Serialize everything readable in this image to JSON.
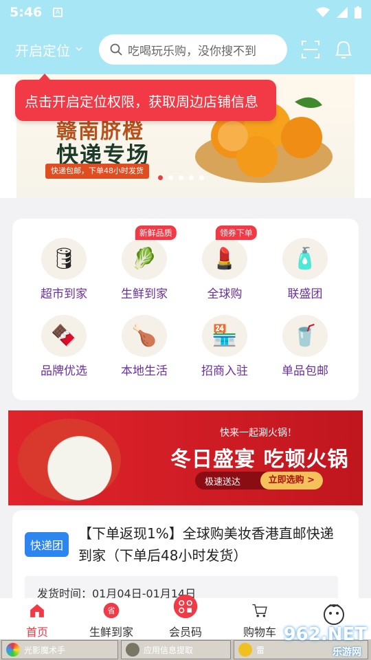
{
  "status_bar": {
    "time": "5:46",
    "icons": [
      "a-icon",
      "wifi-icon",
      "signal-icon",
      "battery-icon"
    ]
  },
  "header": {
    "location_label": "开启定位",
    "search_placeholder": "吃喝玩乐购，没你搜不到",
    "icons": [
      "scan-icon",
      "bell-icon"
    ]
  },
  "banner": {
    "title_top": "赣南脐橙",
    "title_main": "快递专场",
    "subtitle": "快递包邮，下单48小时发货",
    "dots": 5,
    "active_dot": 0
  },
  "tooltip": {
    "text": "点击开启定位权限，获取周边店铺信息"
  },
  "categories": [
    {
      "label": "超市到家",
      "tag": "",
      "icon": "oil-bottle-icon",
      "emoji": "🛢"
    },
    {
      "label": "生鲜到家",
      "tag": "新鲜品质",
      "icon": "vegetables-icon",
      "emoji": "🥬"
    },
    {
      "label": "全球购",
      "tag": "领券下单",
      "icon": "cosmetics-icon",
      "emoji": "💄"
    },
    {
      "label": "联盛团",
      "tag": "",
      "icon": "shampoo-icon",
      "emoji": "🧴"
    },
    {
      "label": "品牌优选",
      "tag": "",
      "icon": "snacks-icon",
      "emoji": "🍫"
    },
    {
      "label": "本地生活",
      "tag": "",
      "icon": "fried-chicken-icon",
      "emoji": "🍗"
    },
    {
      "label": "招商入驻",
      "tag": "",
      "icon": "store-icon",
      "emoji": "🏪"
    },
    {
      "label": "单品包邮",
      "tag": "",
      "icon": "blender-icon",
      "emoji": "🥤"
    }
  ],
  "promo": {
    "line1": "快来一起涮火锅！",
    "line2": "冬日盛宴 吃顿火锅",
    "pill_left": "极速送达",
    "pill_right": "立即选购 >"
  },
  "deal_card": {
    "badge": "快递团",
    "title": "【下单返现1%】全球购美妆香港直邮快递到家（下单后48小时发货）",
    "ship_time": "发货时间：01月04日-01月14日"
  },
  "tabbar": [
    {
      "label": "首页",
      "icon": "home-icon",
      "active": true
    },
    {
      "label": "生鲜到家",
      "icon": "fresh-icon",
      "active": false
    },
    {
      "label": "会员码",
      "icon": "member-code-icon",
      "active": false
    },
    {
      "label": "购物车",
      "icon": "cart-icon",
      "active": false
    },
    {
      "label": "",
      "icon": "profile-icon",
      "active": false
    }
  ],
  "taskbar": [
    {
      "label": "光影魔术手"
    },
    {
      "label": "应用信息提取"
    },
    {
      "label": "雷"
    }
  ],
  "watermark": {
    "brand": "962.NET",
    "site": "乐游网"
  },
  "colors": {
    "header_bg": "#a6e6f5",
    "accent_red": "#f23a46",
    "badge_blue": "#2d86f0",
    "category_label": "#6a2fa0"
  }
}
